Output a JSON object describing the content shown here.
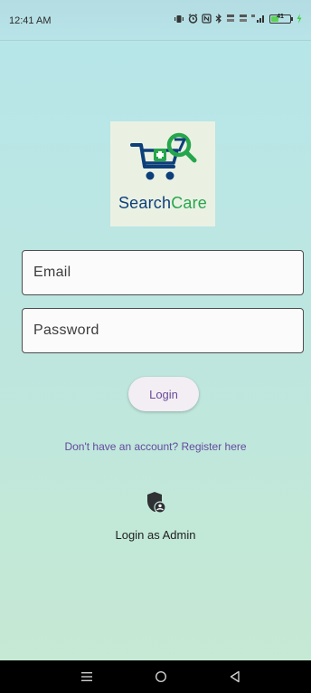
{
  "status_bar": {
    "time": "12:41 AM",
    "battery_level": "41",
    "battery_fill_fraction": 0.41
  },
  "logo": {
    "word_part1": "Search",
    "word_part2": "Care",
    "colors": {
      "search": "#0d3f7a",
      "care": "#26a64c"
    }
  },
  "form": {
    "email_placeholder": "Email",
    "password_placeholder": "Password",
    "email_value": "",
    "password_value": "",
    "login_label": "Login"
  },
  "register_link": "Don't have an account? Register here",
  "admin": {
    "icon": "shield-account-icon",
    "label": "Login as Admin"
  },
  "nav": {
    "icons": [
      "menu-icon",
      "home-icon",
      "back-icon"
    ]
  },
  "theme": {
    "accent": "#6a4a9a",
    "link": "#6349a0",
    "background_top": "#b6e6ea",
    "background_bottom": "#c6e9d2"
  }
}
